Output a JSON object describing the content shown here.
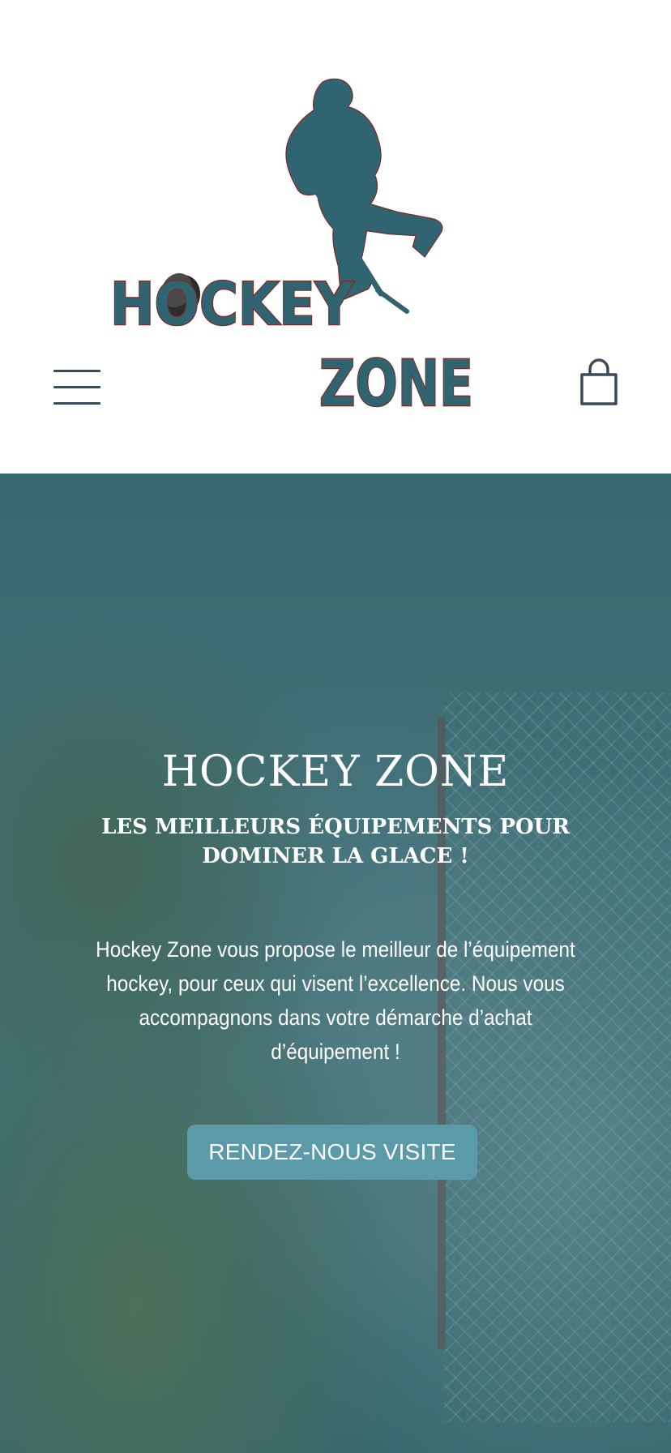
{
  "header": {
    "logo_line1": "HOCKEY",
    "logo_line2": "ZONE",
    "menu_icon": "hamburger-menu-icon",
    "cart_icon": "shopping-bag-icon"
  },
  "hero": {
    "title": "HOCKEY ZONE",
    "subtitle": "LES MEILLEURS ÉQUIPEMENTS POUR DOMINER LA GLACE !",
    "description": "Hockey Zone vous propose le meilleur de l’équipement hockey, pour ceux qui visent l’excellence. Nous vous accompagnons dans votre démarche d’achat d’équipement !",
    "cta_label": "RENDEZ-NOUS VISITE"
  },
  "colors": {
    "brand_teal": "#2f6470",
    "brand_red": "#7c2a2a",
    "cta": "#5b9aa8",
    "icon": "#3d4a57"
  }
}
